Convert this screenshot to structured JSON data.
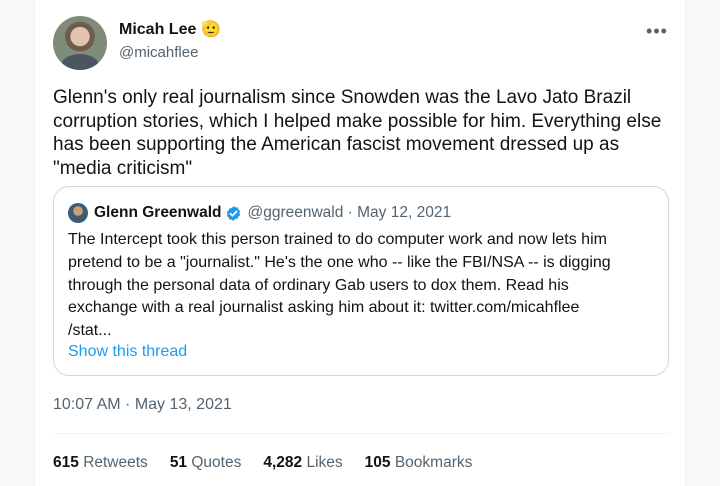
{
  "tweet": {
    "author_name": "Micah Lee",
    "author_emoji": "🫡",
    "author_handle": "@micahflee",
    "more_icon": "•••",
    "text": "Glenn's only real journalism since Snowden was the Lavo Jato Brazil\ncorruption stories, which I helped make possible for him. Everything else\nhas been supporting the American fascist movement dressed up as\n\"media criticism\"",
    "timestamp": "10:07 AM · May 13, 2021"
  },
  "quote": {
    "author_name": "Glenn Greenwald",
    "author_handle": "@ggreenwald · May 12, 2021",
    "text": "The Intercept took this person trained to do computer work and now lets him\npretend to be a \"journalist.\" He's the one who -- like the FBI/NSA -- is digging\nthrough the personal data of ordinary Gab users to dox them. Read his\nexchange with a real journalist asking him about it: twitter.com/micahflee\n/stat...",
    "show_thread": "Show this thread"
  },
  "stats": {
    "retweets_count": "615",
    "retweets_label": "Retweets",
    "quotes_count": "51",
    "quotes_label": "Quotes",
    "likes_count": "4,282",
    "likes_label": "Likes",
    "bookmarks_count": "105",
    "bookmarks_label": "Bookmarks"
  },
  "colors": {
    "accent": "#1d9bf0",
    "secondary_text": "#536471",
    "border": "#cfd9de"
  }
}
